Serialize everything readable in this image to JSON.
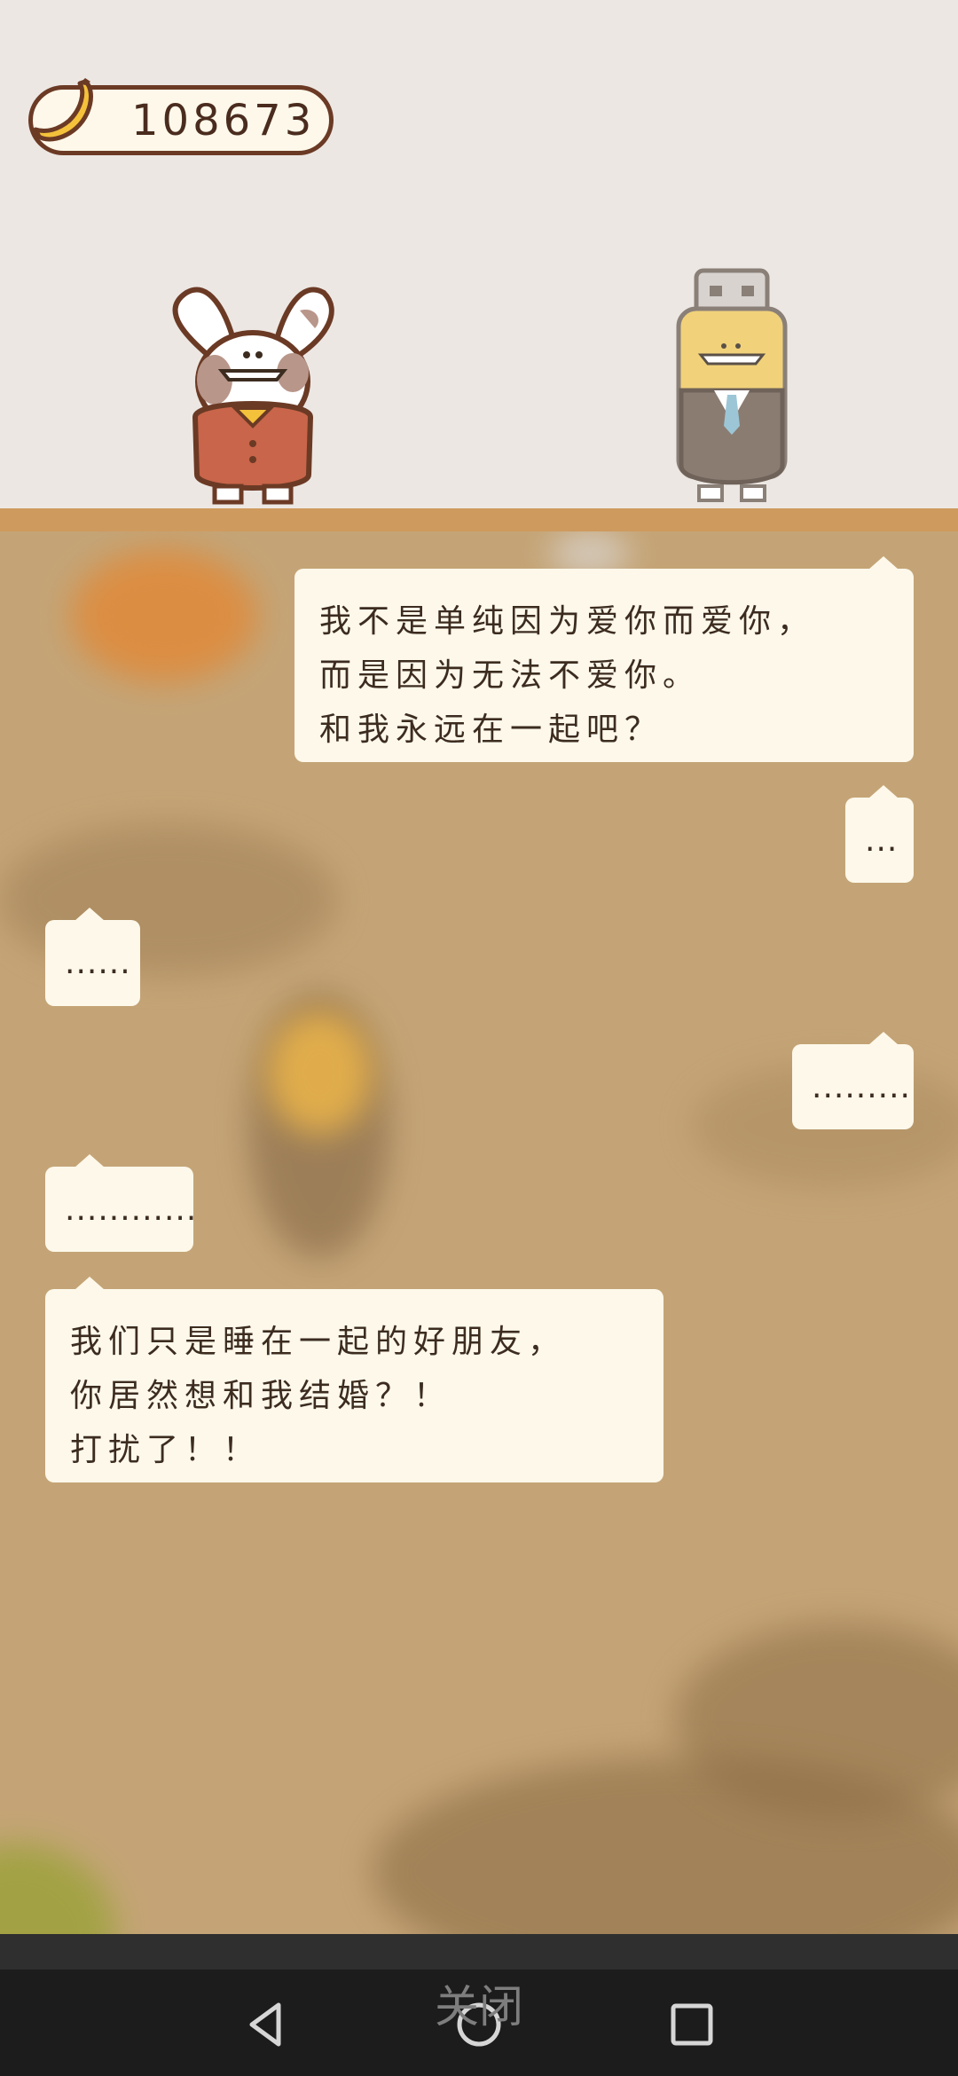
{
  "header": {
    "banana_count": "108673"
  },
  "characters": {
    "left": "rabbit-character",
    "right": "robot-character"
  },
  "dialog": [
    {
      "speaker": "right",
      "lines": [
        "我不是单纯因为爱你而爱你，",
        "而是因为无法不爱你。",
        "和我永远在一起吧？"
      ]
    },
    {
      "speaker": "right",
      "lines": [
        "..."
      ]
    },
    {
      "speaker": "left",
      "lines": [
        "......"
      ]
    },
    {
      "speaker": "right",
      "lines": [
        "........."
      ]
    },
    {
      "speaker": "left",
      "lines": [
        "............"
      ]
    },
    {
      "speaker": "left",
      "lines": [
        "我们只是睡在一起的好朋友，",
        "你居然想和我结婚？！",
        "打扰了！！"
      ]
    }
  ],
  "footer": {
    "close_label": "关闭"
  },
  "navbar": {
    "back": "back-icon",
    "home": "home-icon",
    "recents": "recents-icon"
  },
  "colors": {
    "top_bg": "#ece7e3",
    "scene_bg": "#c4a476",
    "shelf": "#cf9a5e",
    "bubble": "#fdf8ea",
    "text": "#3c2c20"
  }
}
